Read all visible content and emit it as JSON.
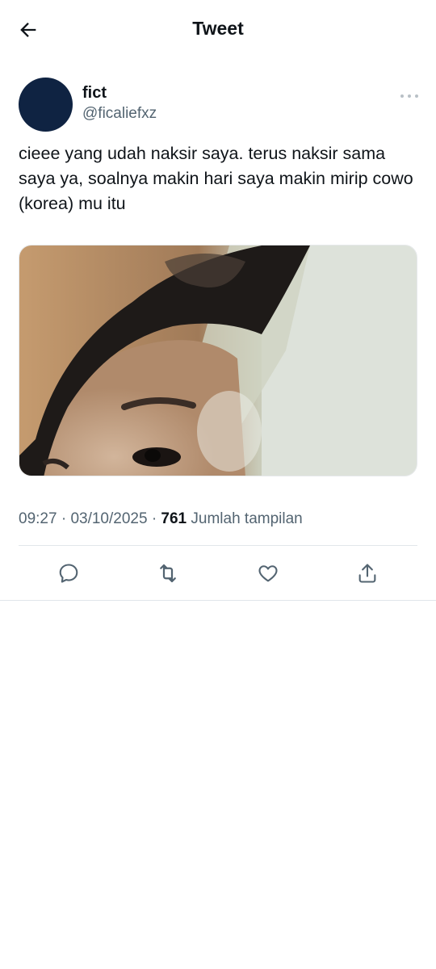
{
  "header": {
    "title": "Tweet",
    "back_icon": "arrow-left-icon"
  },
  "author": {
    "name": "fict",
    "handle": "@ficaliefxz",
    "avatar_color": "#0f2342"
  },
  "tweet": {
    "text": "cieee yang udah naksir saya. terus naksir sama saya ya, soalnya makin hari saya makin mirip cowo (korea) mu itu",
    "time": "09:27",
    "date": "03/10/2025",
    "views_count": "761",
    "views_label": "Jumlah tampilan"
  },
  "actions": {
    "reply_icon": "reply-icon",
    "retweet_icon": "retweet-icon",
    "like_icon": "heart-icon",
    "share_icon": "share-icon"
  },
  "colors": {
    "text_primary": "#0f1419",
    "text_secondary": "#536471",
    "divider": "#e1e6ea"
  }
}
